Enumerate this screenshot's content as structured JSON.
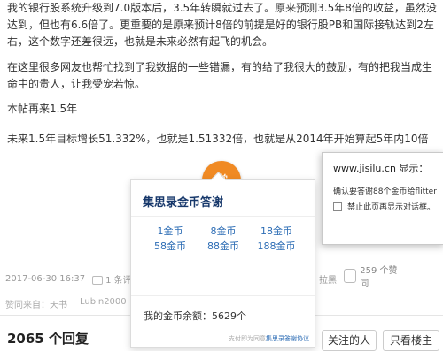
{
  "post": {
    "p1": "我的银行股系统升级到7.0版本后，3.5年转瞬就过去了。原来预测3.5年8倍的收益，虽然没达到，但也有6.6倍了。更重要的是原来预计8倍的前提是好的银行股PB和国际接轨达到2左右，这个数字还差很远，也就是未来必然有起飞的机会。",
    "p2": "在这里很多网友也帮忙找到了我数据的一些错漏，有的给了我很大的鼓励，有的把我当成生命中的贵人，让我受宠若惊。",
    "p3": "本帖再来1.5年",
    "p4": "未来1.5年目标增长51.332%，也就是1.51332倍，也就是从2014年开始算起5年内10倍"
  },
  "meta": {
    "date": "2017-06-30 16:37",
    "comments": "1 条评论",
    "hint": "拉黑",
    "likes": "259 个赞同"
  },
  "thanks": {
    "label": "赞同来自：天书",
    "user1": "Lubin2000"
  },
  "reply_count": "2065 个回复",
  "buttons": {
    "follow": "关注的人",
    "only_op": "只看楼主"
  },
  "coin_button": "赏",
  "popup": {
    "title": "集思录金币答谢",
    "options": [
      "1金币",
      "8金币",
      "18金币",
      "58金币",
      "88金币",
      "188金币"
    ],
    "balance": "我的金币余额：5629个",
    "footer_text": "支付即为同意",
    "footer_link": "集思录答谢协议"
  },
  "alert": {
    "title": "www.jisilu.cn 显示：",
    "message": "确认要答谢88个金币给flitter",
    "checkbox_label": "禁止此页再显示对话框。"
  }
}
